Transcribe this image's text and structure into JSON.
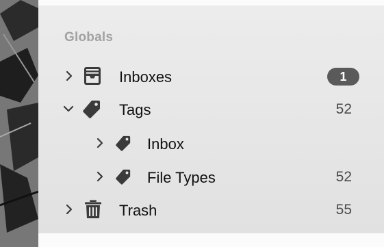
{
  "sidebar": {
    "section_header": "Globals",
    "items": [
      {
        "label": "Inboxes",
        "badge": "1",
        "count": null,
        "icon": "inbox-tray-icon",
        "expanded": false,
        "level": 0
      },
      {
        "label": "Tags",
        "count": "52",
        "icon": "tag-icon",
        "expanded": true,
        "level": 0
      },
      {
        "label": "Inbox",
        "count": null,
        "icon": "tag-icon",
        "expanded": false,
        "level": 1
      },
      {
        "label": "File Types",
        "count": "52",
        "icon": "tag-icon",
        "expanded": false,
        "level": 1
      },
      {
        "label": "Trash",
        "count": "55",
        "icon": "trash-icon",
        "expanded": false,
        "level": 0
      }
    ]
  }
}
